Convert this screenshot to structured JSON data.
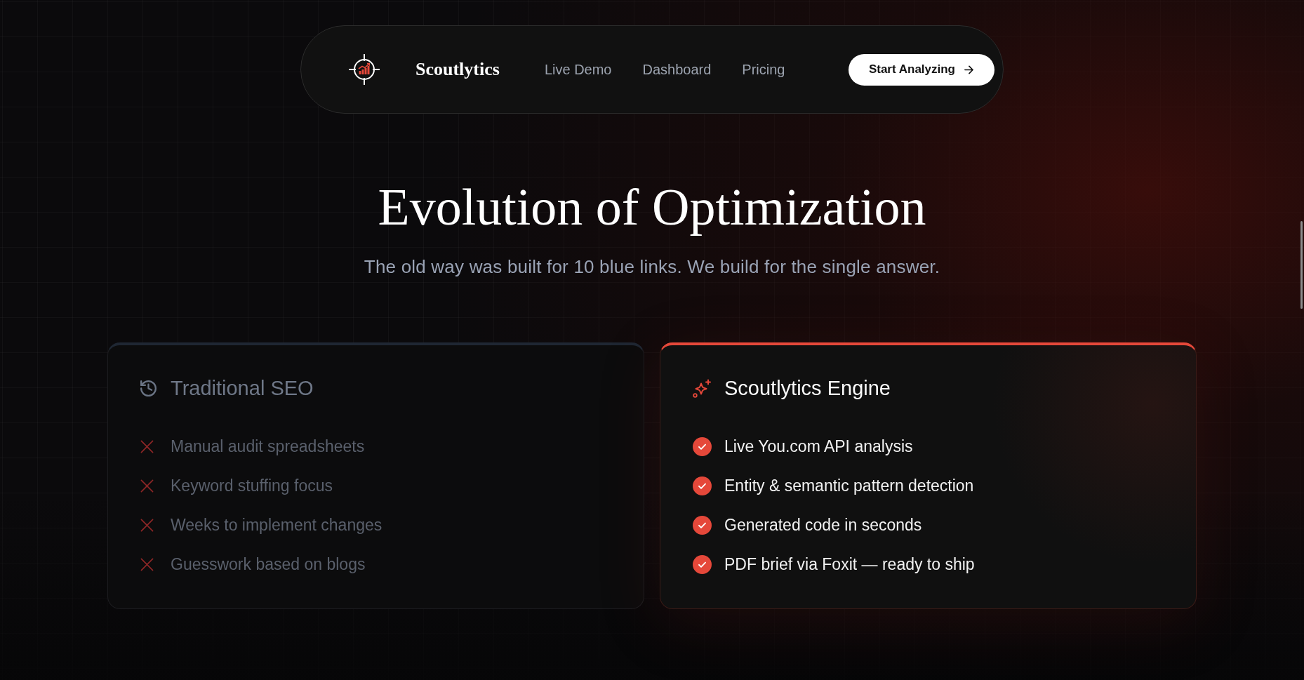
{
  "nav": {
    "brand": "Scoutlytics",
    "links": [
      {
        "label": "Live Demo"
      },
      {
        "label": "Dashboard"
      },
      {
        "label": "Pricing"
      }
    ],
    "cta": {
      "label": "Start Analyzing"
    }
  },
  "hero": {
    "title": "Evolution of Optimization",
    "subtitle": "The old way was built for 10 blue links. We build for the single answer."
  },
  "cards": [
    {
      "kind": "legacy",
      "title": "Traditional SEO",
      "items": [
        "Manual audit spreadsheets",
        "Keyword stuffing focus",
        "Weeks to implement changes",
        "Guesswork based on blogs"
      ]
    },
    {
      "kind": "featured",
      "title": "Scoutlytics Engine",
      "items": [
        "Live You.com API analysis",
        "Entity & semantic pattern detection",
        "Generated code in seconds",
        "PDF brief via Foxit — ready to ship"
      ]
    }
  ]
}
